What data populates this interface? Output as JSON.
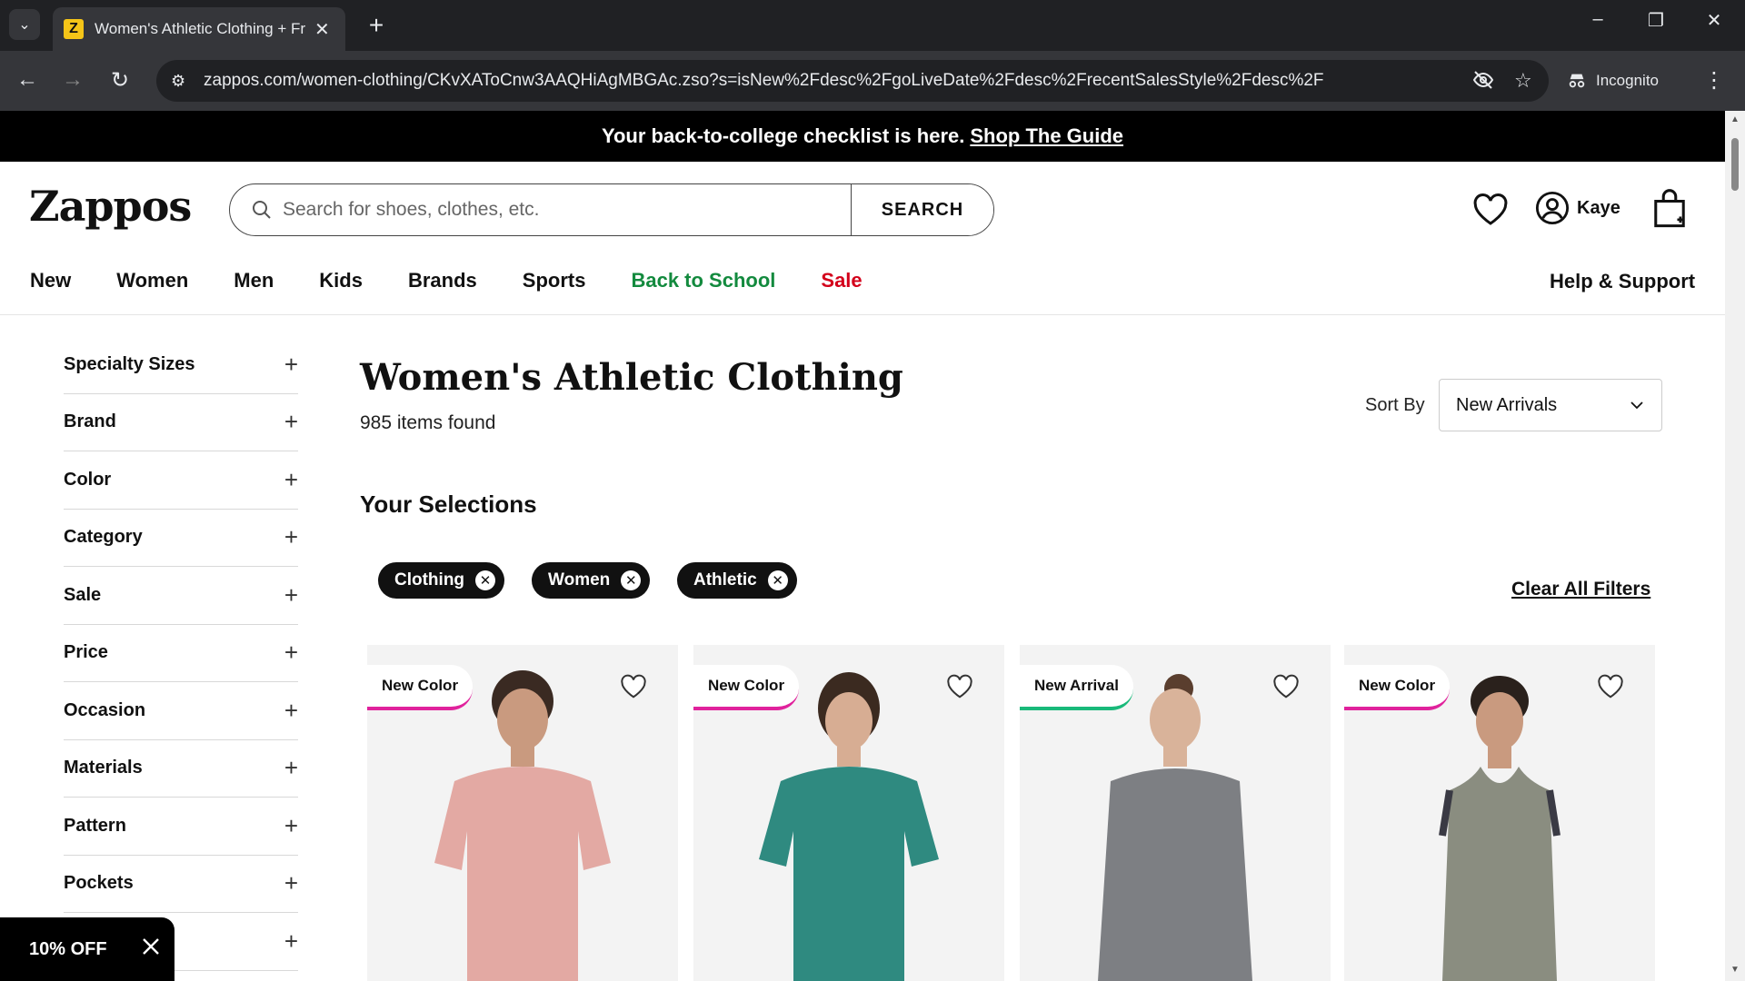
{
  "browser": {
    "tab_title": "Women's Athletic Clothing + Fr",
    "favicon_letter": "Z",
    "url": "zappos.com/women-clothing/CKvXAToCnw3AAQHiAgMBGAc.zso?s=isNew%2Fdesc%2FgoLiveDate%2Fdesc%2FrecentSalesStyle%2Fdesc%2F",
    "incognito_label": "Incognito"
  },
  "promo": {
    "text": "Your back-to-college checklist is here.",
    "link": "Shop The Guide"
  },
  "header": {
    "logo": "Zappos",
    "search_placeholder": "Search for shoes, clothes, etc.",
    "search_button": "SEARCH",
    "user_name": "Kaye"
  },
  "nav": {
    "items": [
      "New",
      "Women",
      "Men",
      "Kids",
      "Brands",
      "Sports",
      "Back to School",
      "Sale"
    ],
    "help": "Help & Support",
    "colors": {
      "back_to_school": "#138a3e",
      "sale": "#d3001a"
    }
  },
  "filters": {
    "facets": [
      "Specialty Sizes",
      "Brand",
      "Color",
      "Category",
      "Sale",
      "Price",
      "Occasion",
      "Materials",
      "Pattern",
      "Pockets",
      ""
    ]
  },
  "results": {
    "title": "Women's Athletic Clothing",
    "count": "985 items found",
    "sort_label": "Sort By",
    "sort_value": "New Arrivals",
    "selections_title": "Your Selections",
    "chips": [
      "Clothing",
      "Women",
      "Athletic"
    ],
    "clear_all": "Clear All Filters"
  },
  "products": [
    {
      "badge": "New Color",
      "badge_color": "#e0229c",
      "shirt_color": "#e3a9a3"
    },
    {
      "badge": "New Color",
      "badge_color": "#e0229c",
      "shirt_color": "#2f8a80"
    },
    {
      "badge": "New Arrival",
      "badge_color": "#19b97a",
      "shirt_color": "#7d7f83"
    },
    {
      "badge": "New Color",
      "badge_color": "#e0229c",
      "shirt_color": "#8a8d80"
    }
  ],
  "coupon": {
    "text": "10% OFF"
  }
}
